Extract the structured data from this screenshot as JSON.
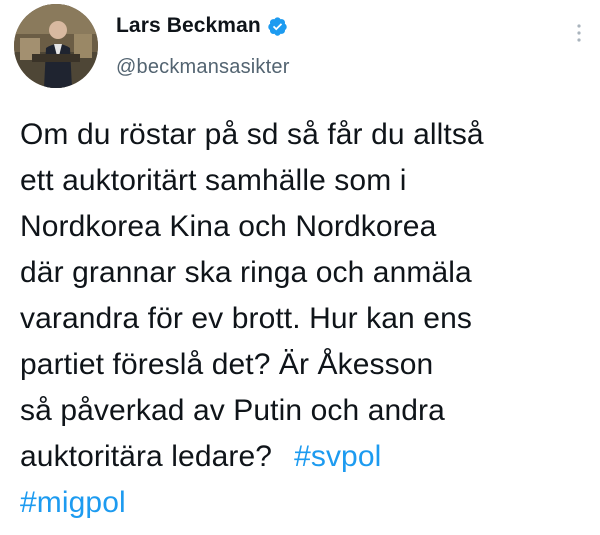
{
  "author": {
    "display_name": "Lars Beckman",
    "handle": "@beckmansasikter",
    "verified": true
  },
  "tweet": {
    "lines": [
      "Om du röstar på sd så får du alltså",
      "ett auktoritärt samhälle som i",
      "Nordkorea Kina och Nordkorea",
      "där grannar ska ringa och anmäla",
      "varandra för ev brott. Hur kan ens",
      "partiet föreslå det? Är Åkesson",
      "så påverkad av Putin och andra",
      "auktoritära ledare?"
    ],
    "hashtags": [
      "#svpol",
      "#migpol"
    ]
  },
  "icons": {
    "verified": "verified-badge-icon",
    "more": "more-options-icon"
  },
  "colors": {
    "accent": "#1d9bf0",
    "text": "#0f1419",
    "secondary": "#536471"
  }
}
